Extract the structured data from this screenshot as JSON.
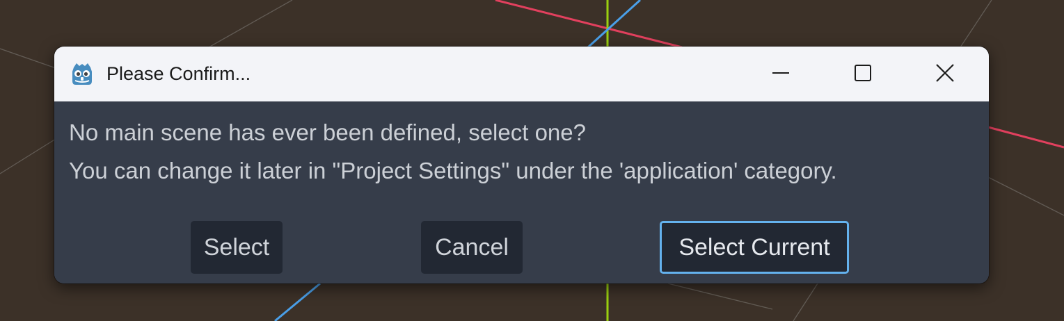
{
  "dialog": {
    "title": "Please Confirm...",
    "app_icon": "godot-icon",
    "window_controls": {
      "minimize": "minimize-icon",
      "maximize": "maximize-icon",
      "close": "close-icon"
    },
    "message_line1": "No main scene has ever been defined, select one?",
    "message_line2": "You can change it later in \"Project Settings\" under the 'application' category.",
    "buttons": {
      "select": "Select",
      "cancel": "Cancel",
      "select_current": "Select Current"
    }
  },
  "colors": {
    "viewport_background": "#3c3128",
    "titlebar": "#f3f4f8",
    "dialog_body": "#363d4a",
    "button_bg": "#222833",
    "focus_border": "#64b2ee",
    "axis_x": "#e2405e",
    "axis_y": "#9bd10f",
    "axis_z": "#4a9fe8"
  }
}
